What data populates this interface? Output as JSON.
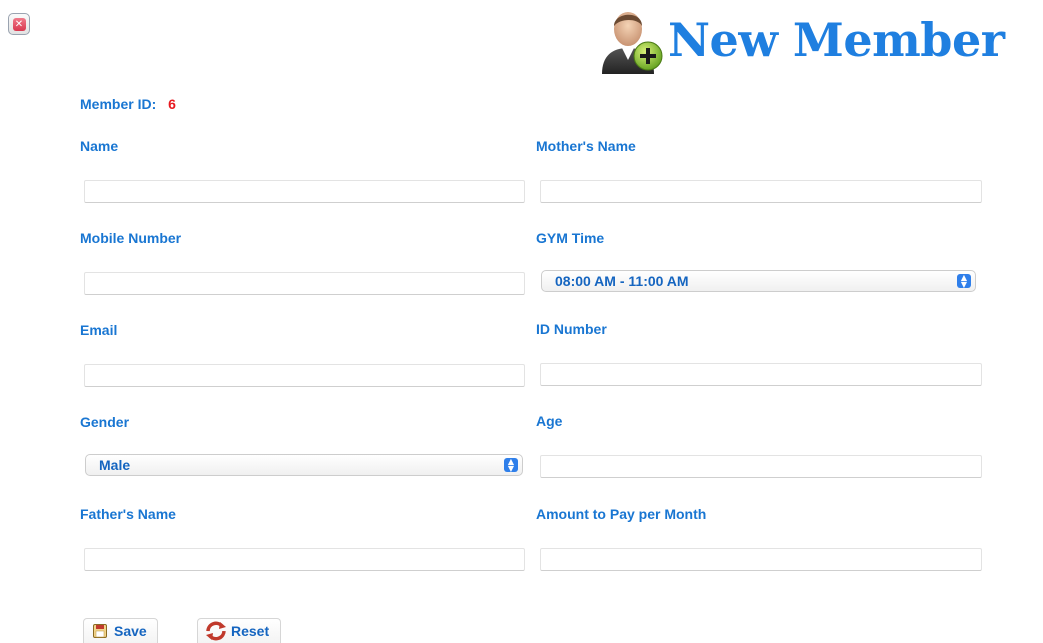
{
  "header": {
    "title": "New Member"
  },
  "member_id": {
    "label": "Member ID:",
    "value": "6"
  },
  "form": {
    "name_label": "Name",
    "mothers_name_label": "Mother's Name",
    "mobile_label": "Mobile Number",
    "gym_time_label": "GYM Time",
    "gym_time_selected": "08:00 AM - 11:00 AM",
    "email_label": "Email",
    "id_number_label": "ID Number",
    "gender_label": "Gender",
    "gender_selected": "Male",
    "age_label": "Age",
    "fathers_name_label": "Father's Name",
    "amount_label": "Amount to Pay per Month"
  },
  "buttons": {
    "save": "Save",
    "reset": "Reset"
  },
  "colors": {
    "label": "#1976d2",
    "title": "#1f7fe0",
    "member_id_value": "#e8191f"
  },
  "icons": [
    "close-icon",
    "add-member-icon",
    "save-icon",
    "reset-icon",
    "select-arrows-icon"
  ]
}
